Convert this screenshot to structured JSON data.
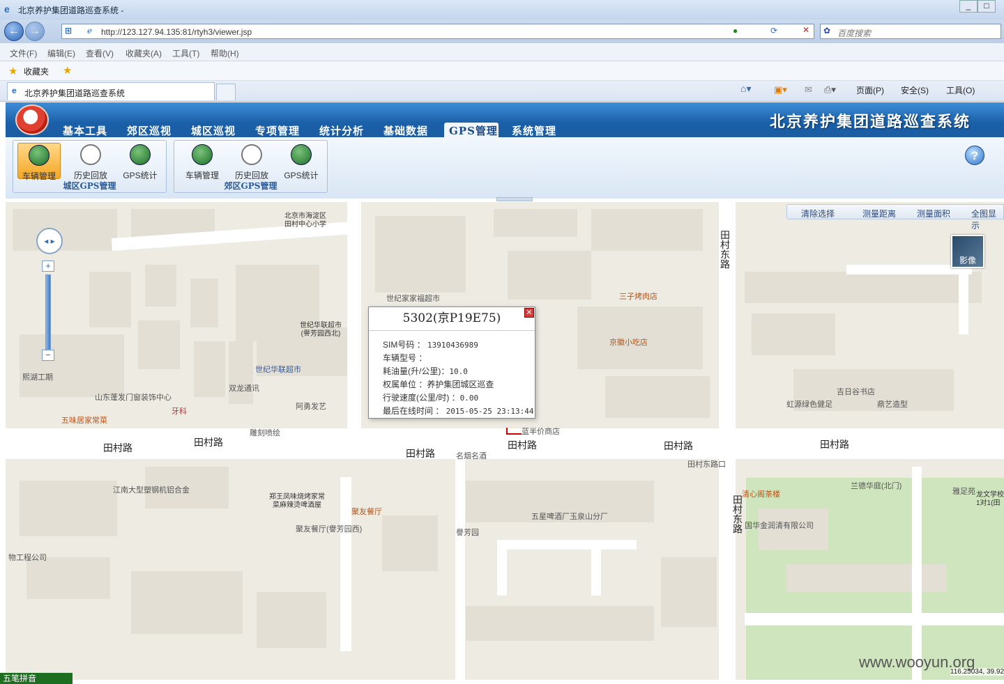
{
  "browser": {
    "window_title": "北京养护集团道路巡查系统 -",
    "url": "http://123.127.94.135:81/rtyh3/viewer.jsp",
    "search_placeholder": "百度搜索",
    "menu": [
      "文件(F)",
      "编辑(E)",
      "查看(V)",
      "收藏夹(A)",
      "工具(T)",
      "帮助(H)"
    ],
    "favorites": "收藏夹",
    "tab_title": "北京养护集团道路巡查系统",
    "commands": [
      "页面(P)",
      "安全(S)",
      "工具(O)"
    ]
  },
  "app": {
    "title": "北京养护集团道路巡查系统",
    "nav": [
      "基本工具",
      "郊区巡视",
      "城区巡视",
      "专项管理",
      "统计分析",
      "基础数据",
      "GPS管理",
      "系统管理"
    ],
    "active_nav": "GPS管理",
    "help": "?",
    "ribbon": {
      "groups": [
        {
          "label": "城区GPS管理",
          "buttons": [
            {
              "label": "车辆管理",
              "icon": "vehicle-gps-icon",
              "active": true
            },
            {
              "label": "历史回放",
              "icon": "history-clock-icon"
            },
            {
              "label": "GPS统计",
              "icon": "gps-stats-icon"
            }
          ]
        },
        {
          "label": "郊区GPS管理",
          "buttons": [
            {
              "label": "车辆管理",
              "icon": "vehicle-gps-icon"
            },
            {
              "label": "历史回放",
              "icon": "history-clock-icon"
            },
            {
              "label": "GPS统计",
              "icon": "gps-stats-icon"
            }
          ]
        }
      ]
    }
  },
  "map": {
    "tools": [
      "清除选择",
      "测量距离",
      "测量面积",
      "全图显示"
    ],
    "satellite_label": "影像",
    "zoom_in": "+",
    "zoom_out": "−",
    "roads": [
      "田村路",
      "田村路",
      "田村路",
      "田村路",
      "田村路",
      "田村路",
      "田村东路",
      "田村东路",
      "田村东路口"
    ],
    "labels": [
      "北京市海淀区\n田村中心小学",
      "世纪家家福超市",
      "世纪华联超市\n(譽芳园西北)",
      "熙湖工期",
      "山东蓬发门窗装饰中心",
      "双龙通讯",
      "世纪华联超市",
      "五味居家常菜",
      "牙科",
      "阿勇发艺",
      "雕刻喷绘",
      "江南大型塑钢机铝合金",
      "郑王凤味烧烤家常\n菜麻辣烫啤酒屋",
      "聚友餐厅",
      "聚友餐厅(譽芳园西)",
      "名烟名酒",
      "譽芳园",
      "五星啤酒厂玉泉山分厂",
      "物工程公司",
      "三子烤肉店",
      "京徽小吃店",
      "蓝半价商店",
      "吉日谷书店",
      "虹源绿色健足",
      "鼎艺造型",
      "清心阁茶楼",
      "兰德华庭(北门)",
      "雅足苑",
      "国华金润清有限公司",
      "龙文学校\n1对1(田"
    ],
    "coords": "116.25034, 39.92"
  },
  "popup": {
    "title": "5302(京P19E75)",
    "rows": [
      {
        "label": "SIM号码 ：",
        "value": "13910436989"
      },
      {
        "label": "车辆型号 ：",
        "value": ""
      },
      {
        "label": "耗油量(升/公里)：",
        "value": "10.0"
      },
      {
        "label": "权属单位 ：",
        "value": "养护集团城区巡查"
      },
      {
        "label": "行驶速度(公里/时) ：",
        "value": "0.00"
      },
      {
        "label": "最后在线时间 ：",
        "value": "2015-05-25 23:13:44"
      }
    ]
  },
  "watermark": "www.wooyun.org",
  "ime": "五笔拼音"
}
